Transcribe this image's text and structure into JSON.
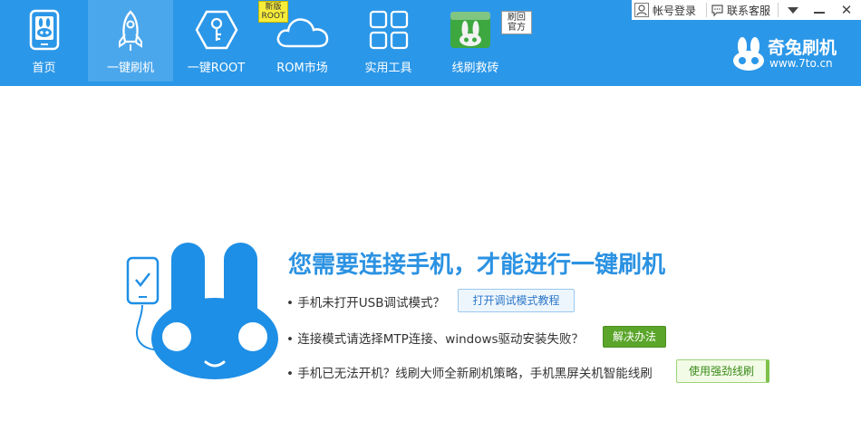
{
  "nav": {
    "items": [
      {
        "label": "首页",
        "icon": "phone-bunny-icon"
      },
      {
        "label": "一键刷机",
        "icon": "rocket-icon",
        "active": true
      },
      {
        "label": "一键ROOT",
        "icon": "key-hexagon-icon"
      },
      {
        "label": "ROM市场",
        "icon": "cloud-icon",
        "badge": "新版ROOT"
      },
      {
        "label": "实用工具",
        "icon": "grid-icon"
      },
      {
        "label": "线刷救砖",
        "icon": "bunny-usb-icon",
        "badge": "刷回官方"
      }
    ]
  },
  "topbar": {
    "login": "帐号登录",
    "support": "联系客服"
  },
  "brand": {
    "name": "奇兔刷机",
    "url": "www.7to.cn"
  },
  "main": {
    "headline": "您需要连接手机，才能进行一键刷机",
    "tips": [
      {
        "text": "• 手机未打开USB调试模式？",
        "button": "打开调试模式教程"
      },
      {
        "text": "• 连接模式请选择MTP连接、windows驱动安装失败？",
        "button": "解决办法"
      },
      {
        "text": "• 手机已无法开机？线刷大师全新刷机策略，手机黑屏关机智能线刷",
        "button": "使用强劲线刷"
      }
    ]
  },
  "colors": {
    "topbar": "#2b97e8",
    "active_tab": "#4ba7ec",
    "headline": "#2b92e2",
    "mascot": "#1e8fe6",
    "solve_button": "#5aa52a"
  }
}
